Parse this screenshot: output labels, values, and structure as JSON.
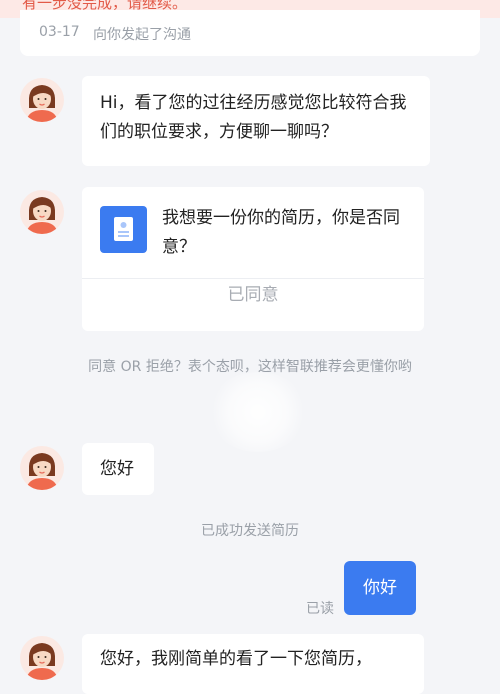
{
  "banner": {
    "text": "有一步没完成，请继续。"
  },
  "header": {
    "date": "03-17",
    "desc": "向你发起了沟通"
  },
  "messages": {
    "m1": "Hi，看了您的过往经历感觉您比较符合我们的职位要求，方便聊一聊吗？",
    "card_text": "我想要一份你的简历，你是否同意？",
    "card_action": "已同意",
    "m2": "您好",
    "out": "你好",
    "m3": "您好，我刚简单的看了一下您简历，"
  },
  "hints": {
    "agree_tip": "同意 OR 拒绝？表个态呗，这样智联推荐会更懂你哟",
    "resume_sent": "已成功发送简历",
    "read_status": "已读"
  },
  "colors": {
    "accent": "#3b7bf0",
    "background": "#f4f5f8",
    "banner": "#fde9e6"
  },
  "icons": {
    "avatar": "recruiter-avatar",
    "doc": "resume-doc-icon"
  }
}
